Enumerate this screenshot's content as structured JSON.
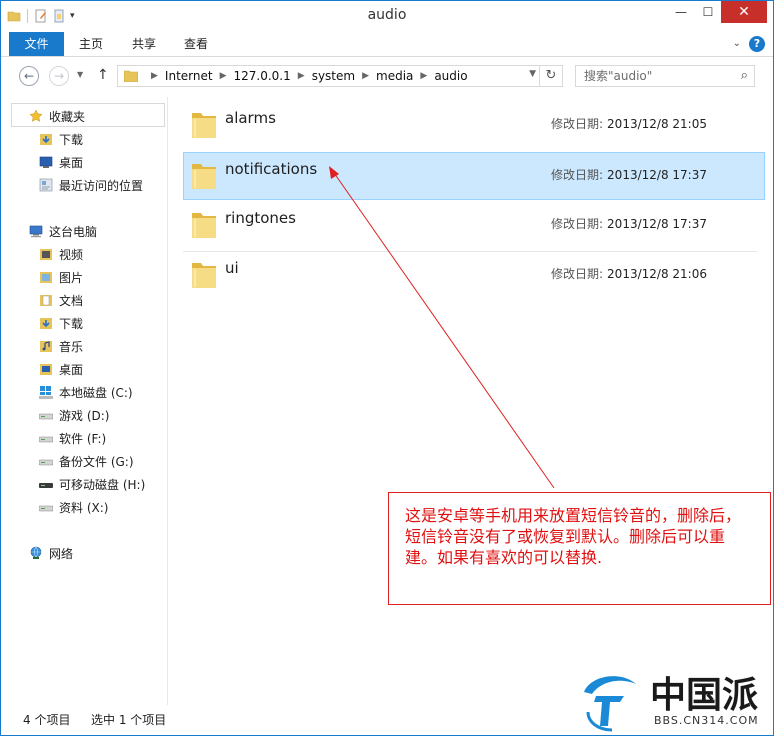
{
  "window": {
    "title": "audio",
    "controls": {
      "minimize": "—",
      "maximize": "☐",
      "close": "✕"
    }
  },
  "ribbon": {
    "tabs": [
      "文件",
      "主页",
      "共享",
      "查看"
    ],
    "help": "?"
  },
  "address": {
    "crumbs": [
      "Internet",
      "127.0.0.1",
      "system",
      "media",
      "audio"
    ],
    "search_placeholder": "搜索\"audio\""
  },
  "sidebar": {
    "favorites": {
      "label": "收藏夹",
      "items": [
        "下载",
        "桌面",
        "最近访问的位置"
      ]
    },
    "computer": {
      "label": "这台电脑",
      "items": [
        "视频",
        "图片",
        "文档",
        "下载",
        "音乐",
        "桌面",
        "本地磁盘 (C:)",
        "游戏 (D:)",
        "软件 (F:)",
        "备份文件 (G:)",
        "可移动磁盘 (H:)",
        "资料 (X:)"
      ]
    },
    "network": {
      "label": "网络"
    }
  },
  "files": [
    {
      "name": "alarms",
      "date_label": "修改日期:",
      "date": "2013/12/8 21:05",
      "selected": false
    },
    {
      "name": "notifications",
      "date_label": "修改日期:",
      "date": "2013/12/8 17:37",
      "selected": true
    },
    {
      "name": "ringtones",
      "date_label": "修改日期:",
      "date": "2013/12/8 17:37",
      "selected": false
    },
    {
      "name": "ui",
      "date_label": "修改日期:",
      "date": "2013/12/8 21:06",
      "selected": false
    }
  ],
  "status": {
    "count": "4 个项目",
    "selected": "选中 1 个项目"
  },
  "annotation": {
    "text": "这是安卓等手机用来放置短信铃音的，删除后，短信铃音没有了或恢复到默认。删除后可以重建。如果有喜欢的可以替换."
  },
  "watermark": {
    "brand": "中国派",
    "site": "BBS.CN314.COM"
  },
  "colors": {
    "accent": "#1979ca",
    "selected_bg": "#cce8ff",
    "annotation": "#e01010"
  }
}
